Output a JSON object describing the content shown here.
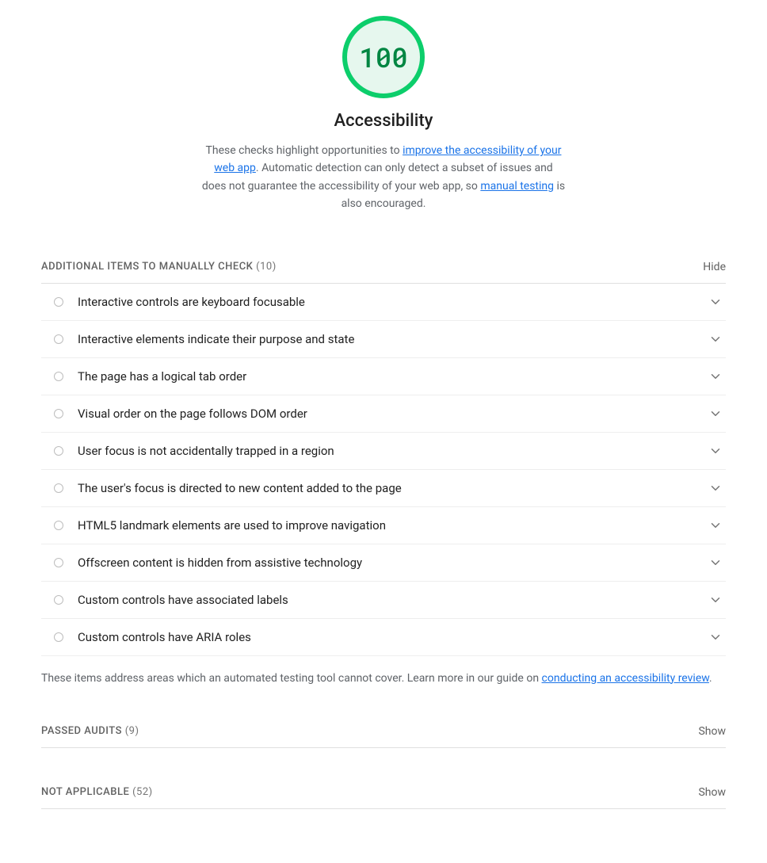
{
  "gauge": {
    "score": "100",
    "title": "Accessibility"
  },
  "description": {
    "part1": "These checks highlight opportunities to ",
    "link1": "improve the accessibility of your web app",
    "part2": ". Automatic detection can only detect a subset of issues and does not guarantee the accessibility of your web app, so ",
    "link2": "manual testing",
    "part3": " is also encouraged."
  },
  "sections": {
    "manual": {
      "label": "Additional items to manually check",
      "count": "(10)",
      "toggle": "Hide",
      "items": [
        "Interactive controls are keyboard focusable",
        "Interactive elements indicate their purpose and state",
        "The page has a logical tab order",
        "Visual order on the page follows DOM order",
        "User focus is not accidentally trapped in a region",
        "The user's focus is directed to new content added to the page",
        "HTML5 landmark elements are used to improve navigation",
        "Offscreen content is hidden from assistive technology",
        "Custom controls have associated labels",
        "Custom controls have ARIA roles"
      ],
      "footer_part1": "These items address areas which an automated testing tool cannot cover. Learn more in our guide on ",
      "footer_link": "conducting an accessibility review",
      "footer_part2": "."
    },
    "passed": {
      "label": "Passed audits",
      "count": "(9)",
      "toggle": "Show"
    },
    "not_applicable": {
      "label": "Not applicable",
      "count": "(52)",
      "toggle": "Show"
    }
  }
}
